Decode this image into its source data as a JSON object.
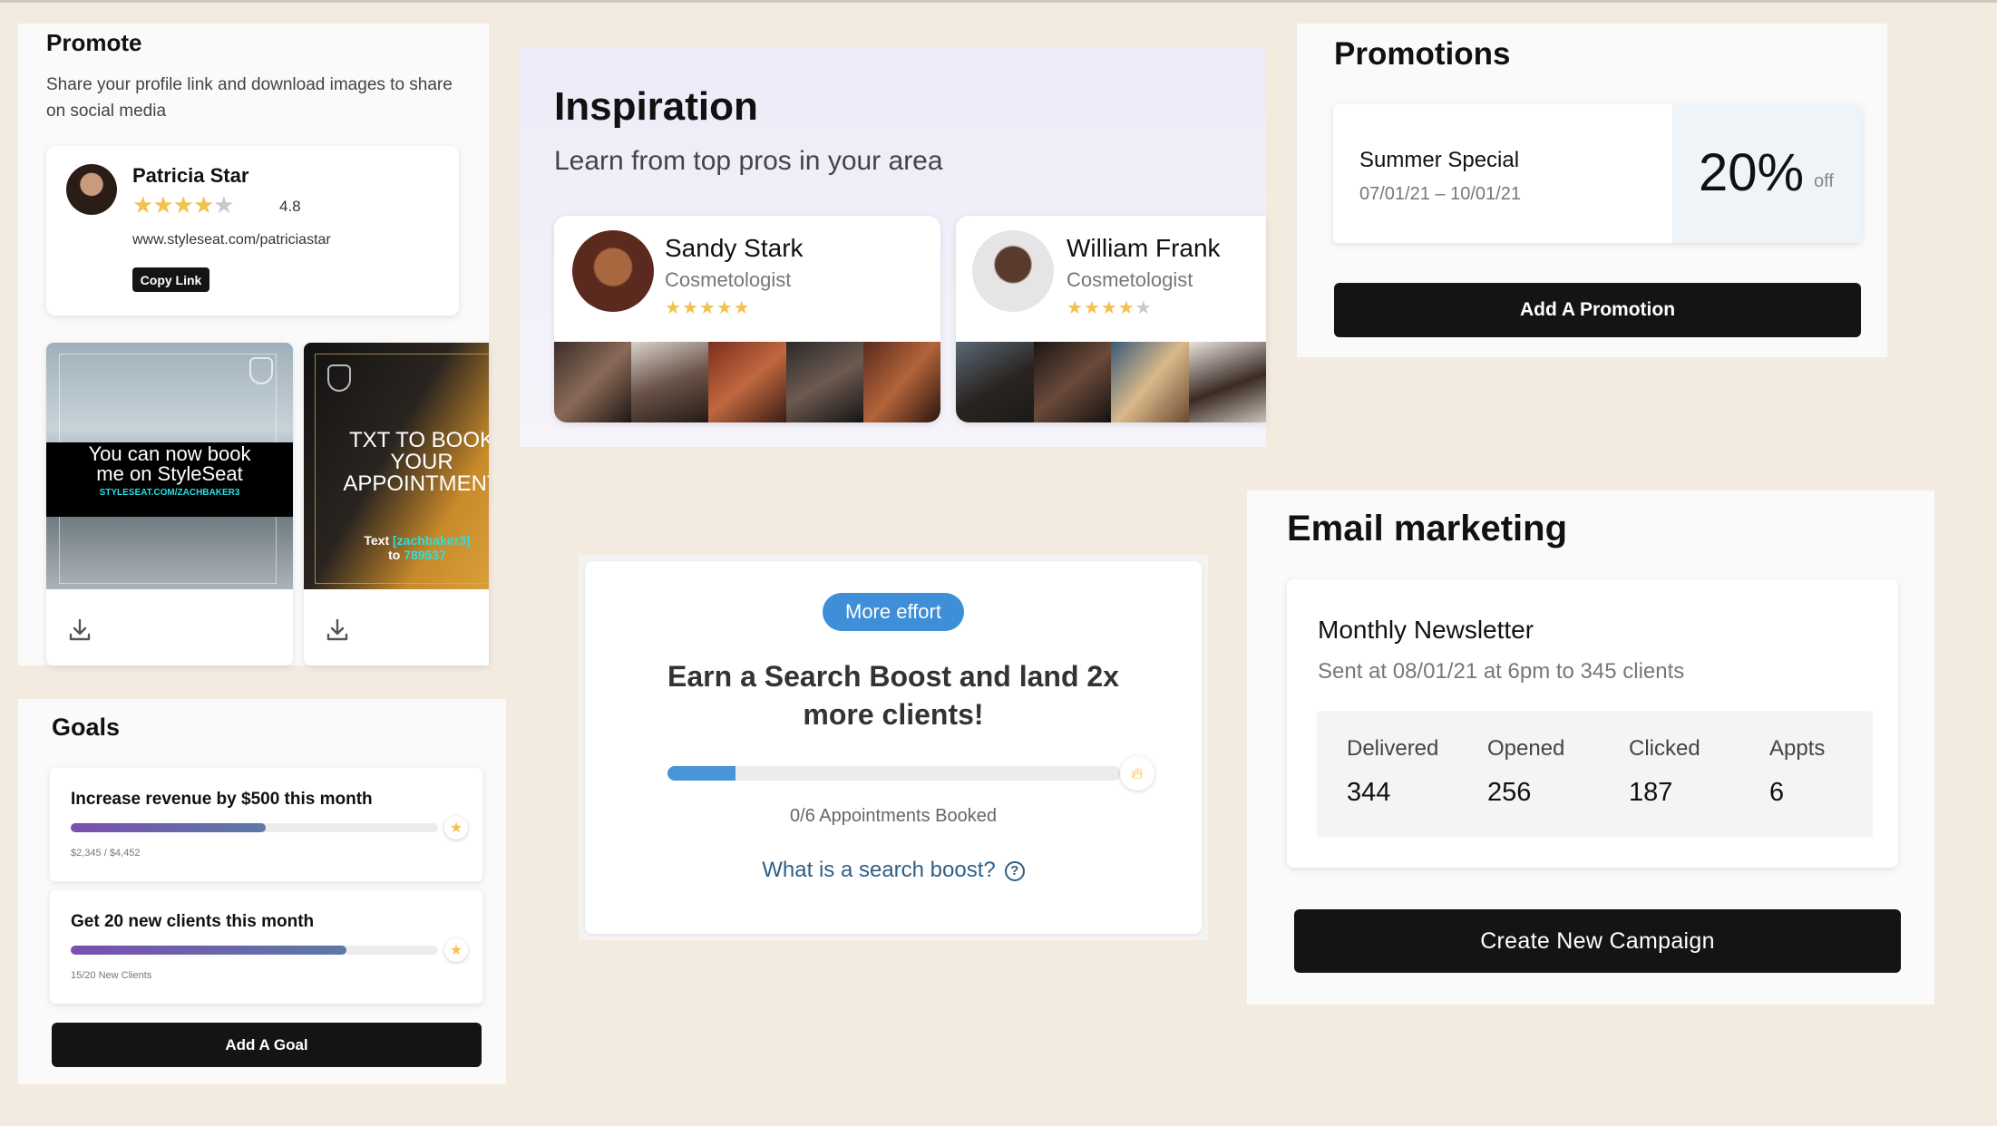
{
  "promote": {
    "title": "Promote",
    "description": "Share your profile link and download images to share on social media",
    "profile": {
      "name": "Patricia Star",
      "rating": "4.8",
      "stars_filled": 4,
      "stars_total": 5,
      "url": "www.styleseat.com/patriciastar",
      "copy_label": "Copy Link"
    },
    "images": [
      {
        "line1": "You can now book me on StyleSeat",
        "line2": "STYLESEAT.COM/ZACHBAKER3",
        "download_icon": "download-icon"
      },
      {
        "line1": "TXT TO BOOK YOUR APPOINTMENT",
        "text_prefix": "Text ",
        "text_handle": "[zachbaker3]",
        "text_to": "to ",
        "text_number": "789537",
        "download_icon": "download-icon"
      }
    ]
  },
  "goals": {
    "title": "Goals",
    "items": [
      {
        "title": "Increase revenue by $500 this month",
        "progress_text": "$2,345 / $4,452",
        "progress": 0.53
      },
      {
        "title": "Get 20 new clients this month",
        "progress_text": "15/20 New Clients",
        "progress": 0.75
      }
    ],
    "add_label": "Add A Goal"
  },
  "inspiration": {
    "title": "Inspiration",
    "subtitle": "Learn from top pros in your area",
    "pros": [
      {
        "name": "Sandy Stark",
        "role": "Cosmetologist",
        "stars_filled": 5,
        "stars_total": 5
      },
      {
        "name": "William Frank",
        "role": "Cosmetologist",
        "stars_filled": 4,
        "stars_total": 5
      }
    ]
  },
  "search_boost": {
    "badge": "More effort",
    "headline": "Earn a Search Boost and land 2x more clients!",
    "progress": 0.15,
    "appointments_text": "0/6 Appointments Booked",
    "help_link": "What is a search boost?",
    "help_icon": "?"
  },
  "promotions": {
    "title": "Promotions",
    "promo": {
      "name": "Summer Special",
      "dates": "07/01/21 – 10/01/21",
      "percent": "20%",
      "off": "off"
    },
    "add_label": "Add A Promotion"
  },
  "email_marketing": {
    "title": "Email marketing",
    "campaign": {
      "name": "Monthly Newsletter",
      "sent": "Sent at 08/01/21 at  6pm to 345 clients"
    },
    "stats": [
      {
        "label": "Delivered",
        "value": "344"
      },
      {
        "label": "Opened",
        "value": "256"
      },
      {
        "label": "Clicked",
        "value": "187"
      },
      {
        "label": "Appts",
        "value": "6"
      }
    ],
    "create_label": "Create New Campaign"
  },
  "colors": {
    "background": "#f3ebe0",
    "accent_blue": "#3e8ed8",
    "button_black": "#141414",
    "star_yellow": "#f2c14e",
    "link_blue": "#2f5f86"
  }
}
